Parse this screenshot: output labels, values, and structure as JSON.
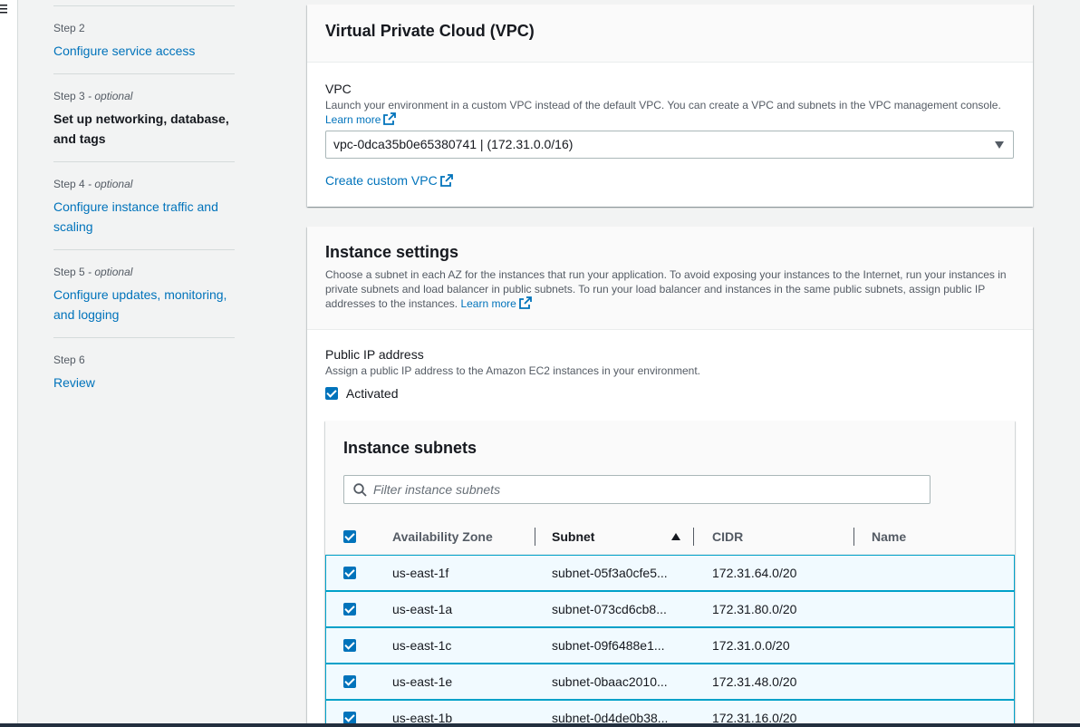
{
  "rail": {
    "icon": "menu-icon"
  },
  "steps": [
    {
      "num": "Step 2",
      "optional": "",
      "label": "Configure service access",
      "current": false
    },
    {
      "num": "Step 3",
      "optional": " - optional",
      "label": "Set up networking, database, and tags",
      "current": true
    },
    {
      "num": "Step 4",
      "optional": " - optional",
      "label": "Configure instance traffic and scaling",
      "current": false
    },
    {
      "num": "Step 5",
      "optional": " - optional",
      "label": "Configure updates, monitoring, and logging",
      "current": false
    },
    {
      "num": "Step 6",
      "optional": "",
      "label": "Review",
      "current": false
    }
  ],
  "vpc_panel": {
    "title": "Virtual Private Cloud (VPC)",
    "field_label": "VPC",
    "description": "Launch your environment in a custom VPC instead of the default VPC. You can create a VPC and subnets in the VPC management console.",
    "learn_more": "Learn more",
    "selected_vpc": "vpc-0dca35b0e65380741 | (172.31.0.0/16)",
    "create_link": "Create custom VPC"
  },
  "instance_panel": {
    "title": "Instance settings",
    "description": "Choose a subnet in each AZ for the instances that run your application. To avoid exposing your instances to the Internet, run your instances in private subnets and load balancer in public subnets. To run your load balancer and instances in the same public subnets, assign public IP addresses to the instances.",
    "learn_more": "Learn more",
    "public_ip_label": "Public IP address",
    "public_ip_desc": "Assign a public IP address to the Amazon EC2 instances in your environment.",
    "activated_label": "Activated",
    "activated_checked": true
  },
  "subnets": {
    "title": "Instance subnets",
    "filter_placeholder": "Filter instance subnets",
    "columns": [
      "Availability Zone",
      "Subnet",
      "CIDR",
      "Name"
    ],
    "sort_column": "Subnet",
    "sort_direction": "ascending",
    "rows": [
      {
        "az": "us-east-1f",
        "subnet": "subnet-05f3a0cfe5...",
        "cidr": "172.31.64.0/20",
        "name": "",
        "checked": true
      },
      {
        "az": "us-east-1a",
        "subnet": "subnet-073cd6cb8...",
        "cidr": "172.31.80.0/20",
        "name": "",
        "checked": true
      },
      {
        "az": "us-east-1c",
        "subnet": "subnet-09f6488e1...",
        "cidr": "172.31.0.0/20",
        "name": "",
        "checked": true
      },
      {
        "az": "us-east-1e",
        "subnet": "subnet-0baac2010...",
        "cidr": "172.31.48.0/20",
        "name": "",
        "checked": true
      },
      {
        "az": "us-east-1b",
        "subnet": "subnet-0d4de0b38...",
        "cidr": "172.31.16.0/20",
        "name": "",
        "checked": true
      }
    ]
  },
  "colors": {
    "link": "#0073bb",
    "selected_row_bg": "#f1faff",
    "selected_row_border": "#00a1c9",
    "checkbox": "#0073bb"
  }
}
